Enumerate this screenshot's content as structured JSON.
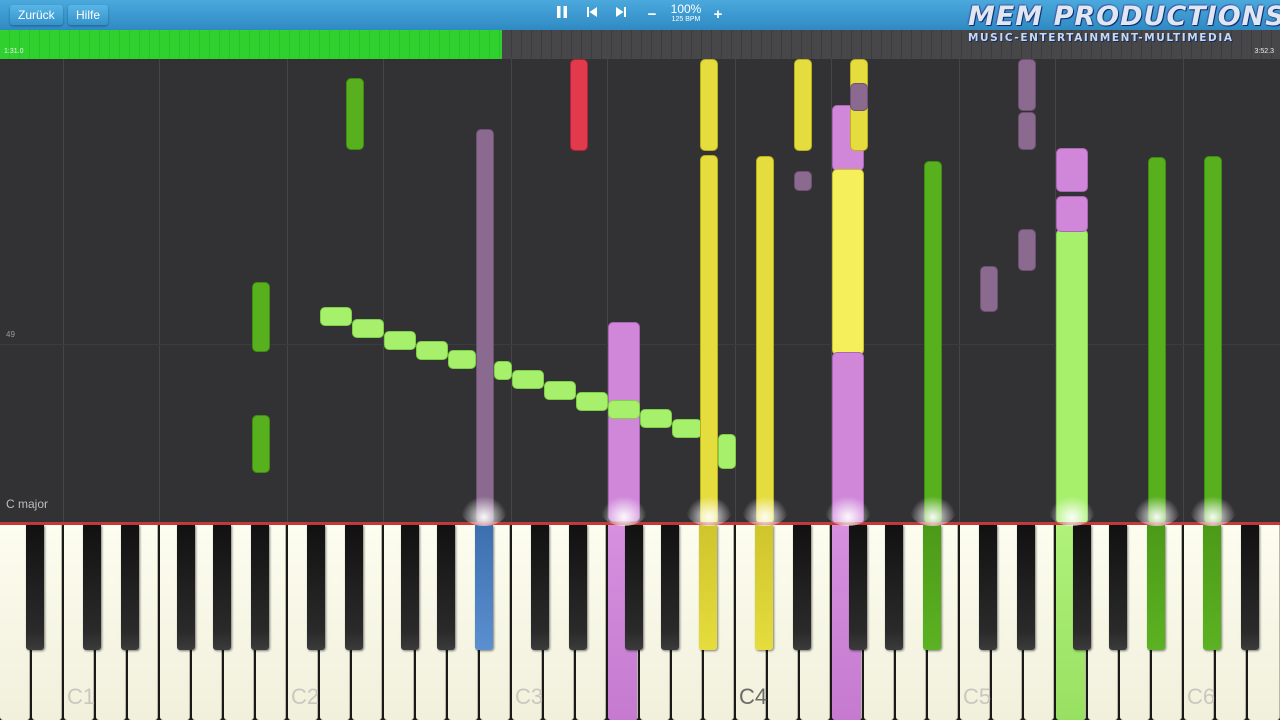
{
  "toolbar": {
    "back_label": "Zurück",
    "help_label": "Hilfe",
    "pause_icon": "pause-icon",
    "prev_icon": "skip-back-icon",
    "next_icon": "skip-forward-icon",
    "minus_label": "−",
    "plus_label": "+",
    "speed_percent": "100%",
    "tempo": "125 BPM"
  },
  "logo": {
    "title": "MEM PRODUCTIONS",
    "subtitle": "MUSIC-ENTERTAINMENT-MULTIMEDIA"
  },
  "progress": {
    "elapsed": "1:31.0",
    "total": "3:52.3",
    "fraction": 0.392
  },
  "roll": {
    "measure_number": "49",
    "key_signature": "C major"
  },
  "keyboard": {
    "labels": [
      "C1",
      "C2",
      "C3",
      "C4",
      "C5",
      "C6"
    ]
  },
  "colors": {
    "topbar": "#3a9ad3",
    "progress": "#2fd12f",
    "light_green": "#a6f06c",
    "dark_green": "#58b01e",
    "yellow": "#e5dc3d",
    "mauve": "#8a6b8f",
    "pink": "#d087da",
    "red": "#e03a4c",
    "pressed_blue": "#4a7fc0"
  }
}
